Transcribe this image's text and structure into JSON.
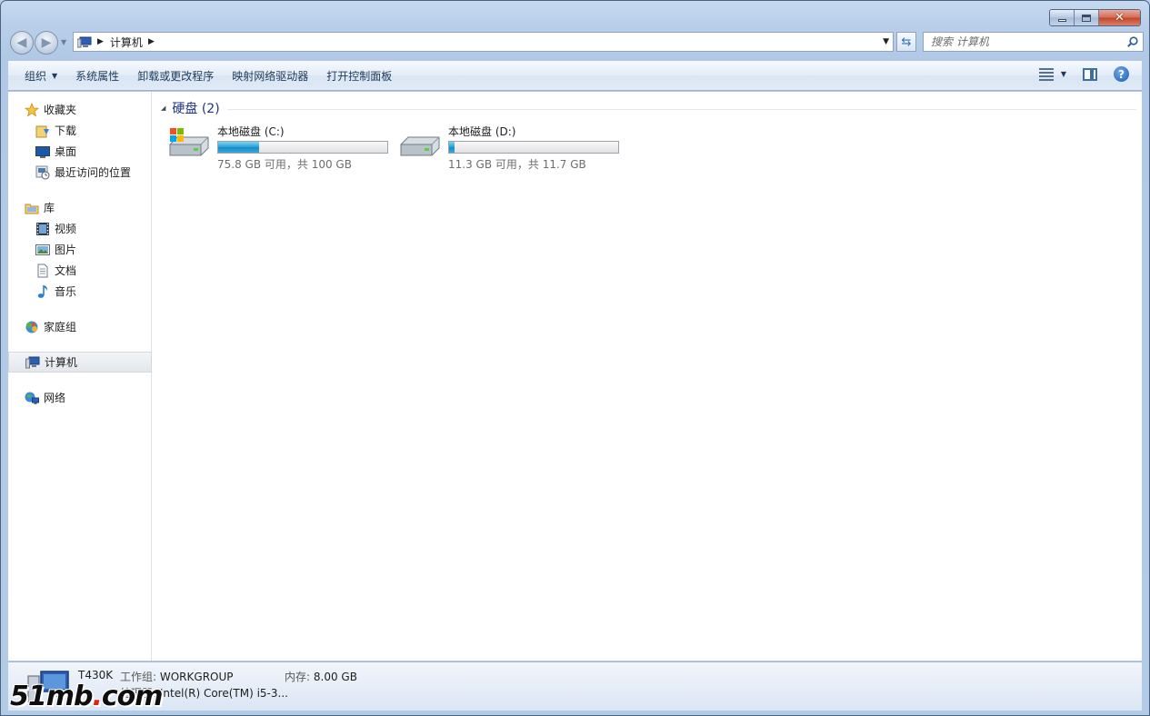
{
  "window": {
    "address_root_label": "计算机",
    "search_placeholder": "搜索 计算机"
  },
  "toolbar": {
    "organize_label": "组织",
    "system_properties_label": "系统属性",
    "uninstall_label": "卸载或更改程序",
    "map_drive_label": "映射网络驱动器",
    "control_panel_label": "打开控制面板"
  },
  "sidebar": {
    "favorites": {
      "label": "收藏夹",
      "items": [
        {
          "label": "下载"
        },
        {
          "label": "桌面"
        },
        {
          "label": "最近访问的位置"
        }
      ]
    },
    "libraries": {
      "label": "库",
      "items": [
        {
          "label": "视频"
        },
        {
          "label": "图片"
        },
        {
          "label": "文档"
        },
        {
          "label": "音乐"
        }
      ]
    },
    "homegroup_label": "家庭组",
    "computer_label": "计算机",
    "network_label": "网络"
  },
  "content": {
    "group_title": "硬盘 (2)",
    "drives": [
      {
        "name": "本地磁盘 (C:)",
        "free_text": "75.8 GB 可用，共 100 GB",
        "used_fraction": 0.242
      },
      {
        "name": "本地磁盘 (D:)",
        "free_text": "11.3 GB 可用，共 11.7 GB",
        "used_fraction": 0.034
      }
    ]
  },
  "details": {
    "computer_name": "T430K",
    "workgroup_label": "工作组:",
    "workgroup_value": "WORKGROUP",
    "memory_label": "内存:",
    "memory_value": "8.00 GB",
    "processor_label": "处理器:",
    "processor_value": "Intel(R) Core(TM) i5-3..."
  },
  "watermark": {
    "text_main": "51mb",
    "text_dot": ".",
    "text_tail": "com"
  },
  "colors": {
    "accent": "#26a0da",
    "group_title": "#1e3287"
  }
}
